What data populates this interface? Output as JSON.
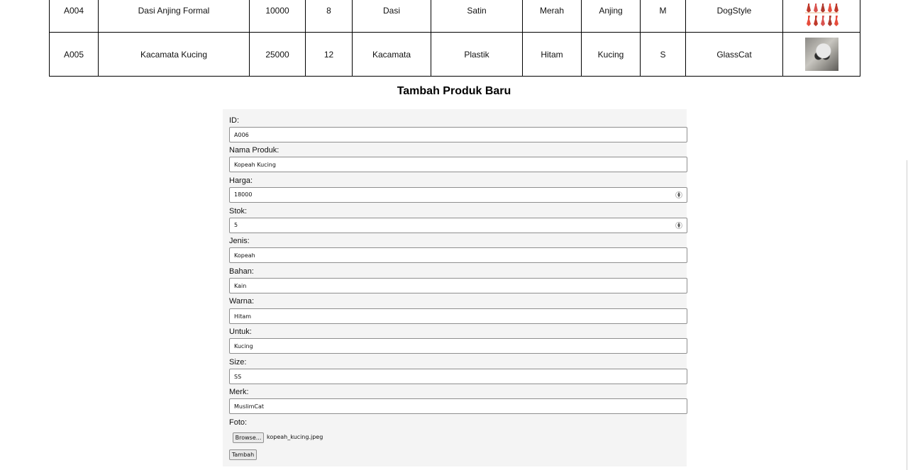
{
  "table": {
    "rows": [
      {
        "id": "A004",
        "nama": "Dasi Anjing Formal",
        "harga": "10000",
        "stok": "8",
        "jenis": "Dasi",
        "bahan": "Satin",
        "warna": "Merah",
        "untuk": "Anjing",
        "size": "M",
        "merk": "DogStyle",
        "foto": "ties-photo"
      },
      {
        "id": "A005",
        "nama": "Kacamata Kucing",
        "harga": "25000",
        "stok": "12",
        "jenis": "Kacamata",
        "bahan": "Plastik",
        "warna": "Hitam",
        "untuk": "Kucing",
        "size": "S",
        "merk": "GlassCat",
        "foto": "cat-sunglasses-photo"
      }
    ]
  },
  "form": {
    "title": "Tambah Produk Baru",
    "fields": {
      "id": {
        "label": "ID:",
        "value": "A006"
      },
      "nama": {
        "label": "Nama Produk:",
        "value": "Kopeah Kucing"
      },
      "harga": {
        "label": "Harga:",
        "value": "18000"
      },
      "stok": {
        "label": "Stok:",
        "value": "5"
      },
      "jenis": {
        "label": "Jenis:",
        "value": "Kopeah"
      },
      "bahan": {
        "label": "Bahan:",
        "value": "Kain"
      },
      "warna": {
        "label": "Warna:",
        "value": "Hitam"
      },
      "untuk": {
        "label": "Untuk:",
        "value": "Kucing"
      },
      "size": {
        "label": "Size:",
        "value": "SS"
      },
      "merk": {
        "label": "Merk:",
        "value": "MuslimCat"
      }
    },
    "foto": {
      "label": "Foto:",
      "browse_label": "Browse...",
      "file_name": "kopeah_kucing.jpeg"
    },
    "submit_label": "Tambah"
  },
  "colors": {
    "panel_bg": "#f4f4f4",
    "border": "#000000",
    "tie_red": "#c0392b"
  }
}
